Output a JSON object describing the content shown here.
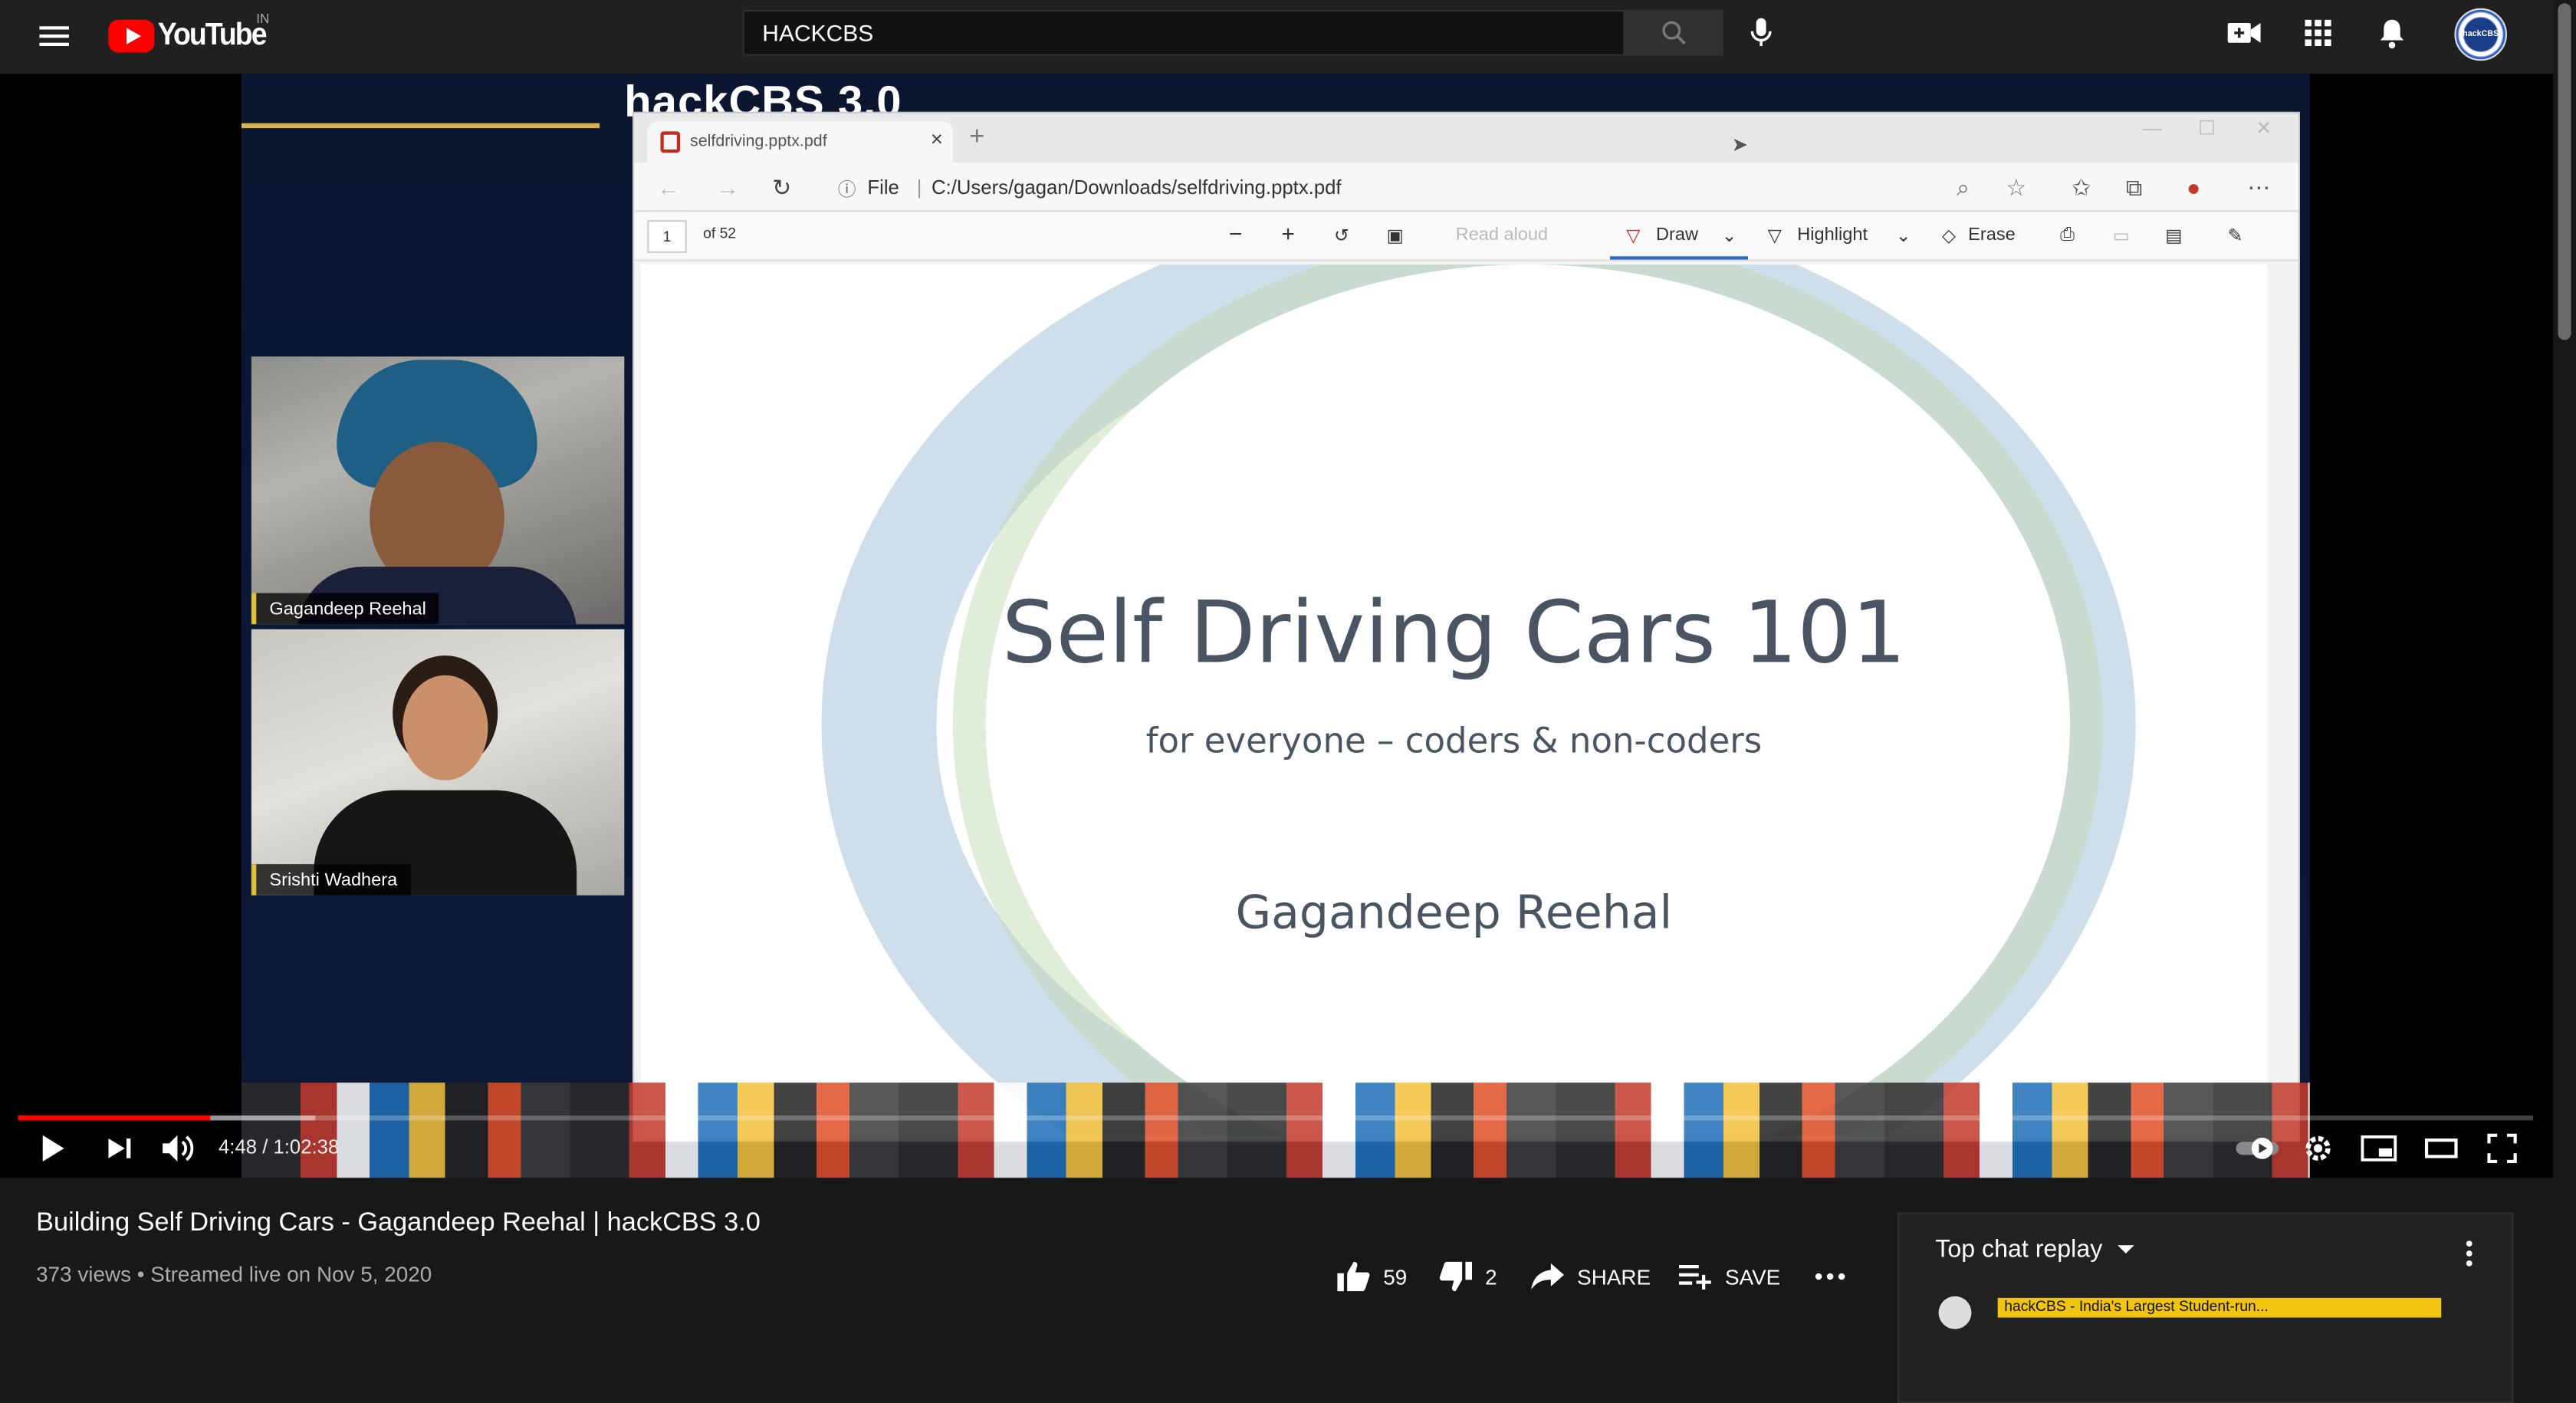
{
  "header": {
    "logo_text": "YouTube",
    "country": "IN",
    "search_value": "HACKCBS",
    "avatar_text": "hackCBS"
  },
  "video_frame": {
    "brand_title": "hackCBS 3.0",
    "participants": [
      {
        "name": "Gagandeep Reehal"
      },
      {
        "name": "Srishti Wadhera"
      }
    ],
    "pdf": {
      "tab_title": "selfdriving.pptx.pdf",
      "address_label": "File",
      "address": "C:/Users/gagan/Downloads/selfdriving.pptx.pdf",
      "page": "1",
      "page_total": "of 52",
      "tools": {
        "read_aloud": "Read aloud",
        "draw": "Draw",
        "highlight": "Highlight",
        "erase": "Erase"
      },
      "slide": {
        "title": "Self Driving Cars 101",
        "subtitle": "for everyone – coders & non-coders",
        "author": "Gagandeep Reehal"
      }
    }
  },
  "player": {
    "time_text": "4:48 / 1:02:38",
    "progress_fraction": 0.0767,
    "loaded_fraction": 0.118
  },
  "video": {
    "title": "Building Self Driving Cars - Gagandeep Reehal | hackCBS 3.0",
    "meta": "373 views • Streamed live on Nov 5, 2020",
    "likes": "59",
    "dislikes": "2",
    "share_label": "SHARE",
    "save_label": "SAVE"
  },
  "chat": {
    "header": "Top chat replay",
    "banner_text": "hackCBS - India's Largest Student-run..."
  },
  "colors": {
    "accent": "#ff0000",
    "background": "#181818",
    "topbar": "#202020",
    "banner": "#f1c40f"
  }
}
